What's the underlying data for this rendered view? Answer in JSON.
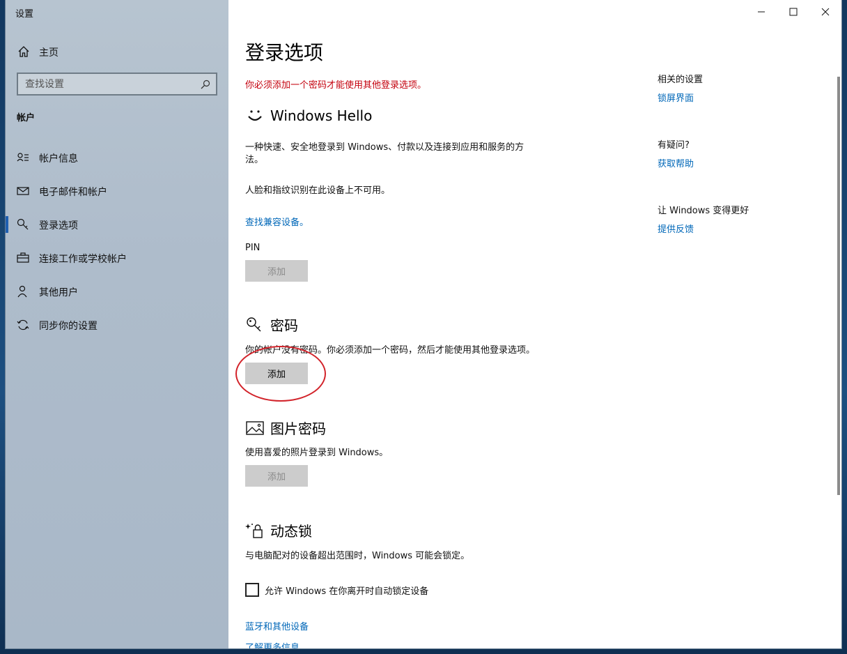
{
  "window": {
    "title": "设置"
  },
  "sidebar": {
    "home_label": "主页",
    "search_placeholder": "查找设置",
    "section_label": "帐户",
    "items": [
      {
        "label": "帐户信息",
        "icon": "account-info-icon"
      },
      {
        "label": "电子邮件和帐户",
        "icon": "mail-icon"
      },
      {
        "label": "登录选项",
        "icon": "key-icon",
        "selected": true
      },
      {
        "label": "连接工作或学校帐户",
        "icon": "briefcase-icon"
      },
      {
        "label": "其他用户",
        "icon": "person-icon"
      },
      {
        "label": "同步你的设置",
        "icon": "sync-icon"
      }
    ]
  },
  "main": {
    "title": "登录选项",
    "warning": "你必须添加一个密码才能使用其他登录选项。",
    "hello": {
      "title": "Windows Hello",
      "desc_line1": "一种快速、安全地登录到 Windows、付款以及连接到应用和服务的方",
      "desc_line2": "法。",
      "unavailable": "人脸和指纹识别在此设备上不可用。",
      "compat_link": "查找兼容设备。",
      "pin_label": "PIN",
      "pin_button": "添加"
    },
    "password": {
      "title": "密码",
      "desc": "你的帐户没有密码。你必须添加一个密码，然后才能使用其他登录选项。",
      "button": "添加"
    },
    "picture_password": {
      "title": "图片密码",
      "desc": "使用喜爱的照片登录到 Windows。",
      "button": "添加"
    },
    "dynamic_lock": {
      "title": "动态锁",
      "desc": "与电脑配对的设备超出范围时，Windows 可能会锁定。",
      "checkbox_label": "允许 Windows 在你离开时自动锁定设备",
      "bt_link": "蓝牙和其他设备",
      "more_link": "了解更多信息"
    }
  },
  "related": {
    "h1": "相关的设置",
    "l1": "锁屏界面",
    "h2": "有疑问?",
    "l2": "获取帮助",
    "h3": "让 Windows 变得更好",
    "l3": "提供反馈"
  },
  "colors": {
    "accent": "#0067b8",
    "warning": "#c4000d",
    "annotation": "#d2232a",
    "selected_bar": "#1f5fb0"
  }
}
